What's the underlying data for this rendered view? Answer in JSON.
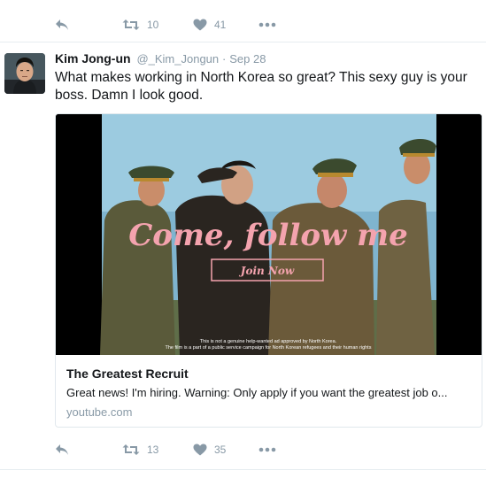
{
  "top_actions": {
    "retweet_count": "10",
    "like_count": "41"
  },
  "tweet": {
    "name": "Kim Jong-un",
    "handle": "@_Kim_Jongun",
    "separator": "·",
    "date": "Sep 28",
    "text": "What makes working in North Korea so great? This sexy guy is your boss. Damn I look good.",
    "card": {
      "overlay_title": "Come, follow me",
      "join_label": "Join Now",
      "disclaimer_line1": "This is not a genuine help-wanted ad approved by North Korea.",
      "disclaimer_line2": "The film is a part of a public service campaign for North Korean refugees and their human rights",
      "title": "The Greatest Recruit",
      "description": "Great news! I'm hiring. Warning: Only apply if you want the greatest job o...",
      "url": "youtube.com"
    }
  },
  "bottom_actions": {
    "retweet_count": "13",
    "like_count": "35"
  },
  "icons": {
    "reply": "reply-icon",
    "retweet": "retweet-icon",
    "like": "heart-icon",
    "more": "more-dots-icon"
  },
  "colors": {
    "icon_gray": "#8899a6",
    "text": "#14171a",
    "overlay_pink": "#f4a3ae"
  }
}
